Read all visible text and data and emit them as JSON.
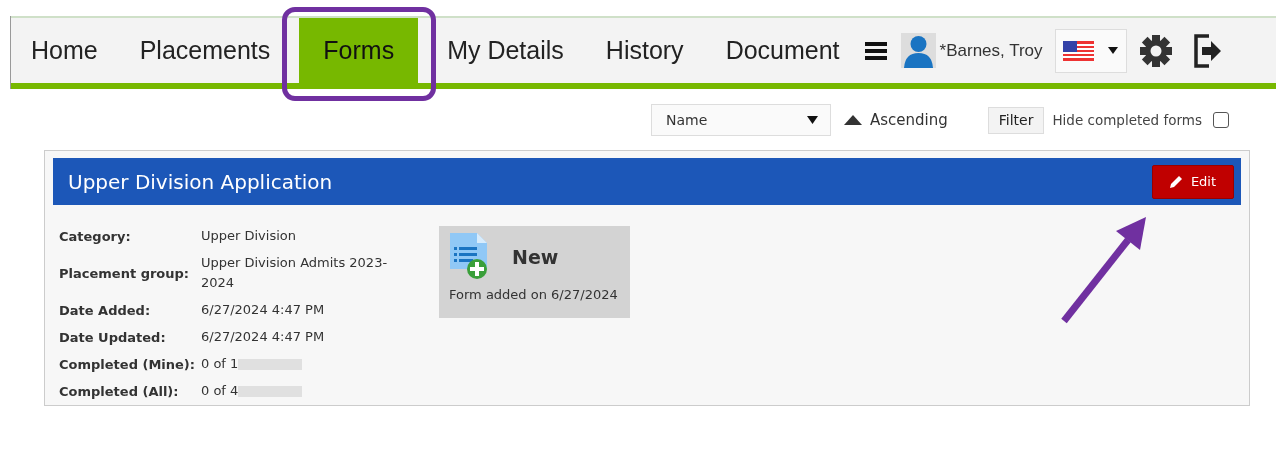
{
  "nav": {
    "tabs": [
      {
        "label": "Home",
        "selected": false
      },
      {
        "label": "Placements",
        "selected": false
      },
      {
        "label": "Forms",
        "selected": true
      },
      {
        "label": "My Details",
        "selected": false
      },
      {
        "label": "History",
        "selected": false
      },
      {
        "label": "Document",
        "selected": false
      }
    ],
    "user": "*Barnes, Troy"
  },
  "toolbar": {
    "sort_field": "Name",
    "sort_order": "Ascending",
    "filter_button": "Filter",
    "hide_completed": {
      "label": "Hide completed forms",
      "checked": false
    }
  },
  "form_card": {
    "title": "Upper Division Application",
    "edit_button": "Edit",
    "details": [
      {
        "label": "Category:",
        "value": "Upper Division",
        "redacted": false
      },
      {
        "label": "Placement group:",
        "value": "Upper Division Admits 2023-2024",
        "redacted": false
      },
      {
        "label": "Date Added:",
        "value": "6/27/2024 4:47 PM",
        "redacted": false
      },
      {
        "label": "Date Updated:",
        "value": "6/27/2024 4:47 PM",
        "redacted": false
      },
      {
        "label": "Completed (Mine):",
        "value": "0 of 1",
        "redacted": true
      },
      {
        "label": "Completed (All):",
        "value": "0 of 4",
        "redacted": true
      }
    ],
    "tile": {
      "title": "New",
      "caption": "Form added on 6/27/2024"
    }
  }
}
